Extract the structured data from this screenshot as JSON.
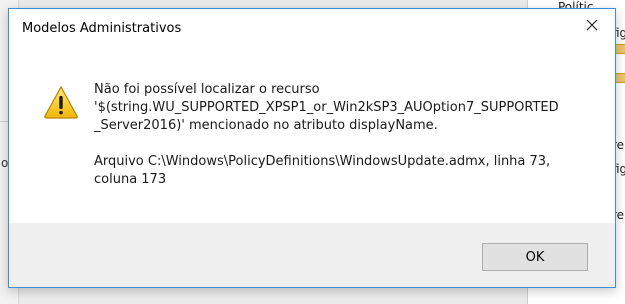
{
  "dialog": {
    "title": "Modelos Administrativos",
    "message_lines": [
      "Não foi possível localizar o recurso",
      "'$(string.WU_SUPPORTED_XPSP1_or_Win2kSP3_AUOption7_SUPPORTED",
      "_Server2016)' mencionado no atributo displayName."
    ],
    "detail_lines": [
      "Arquivo C:\\Windows\\PolicyDefinitions\\WindowsUpdate.admx, linha 73,",
      "coluna 173"
    ],
    "ok_label": "OK",
    "icon": "warning-icon"
  },
  "background": {
    "left_text": "oo",
    "right_snippets": [
      "Polític",
      "fig",
      "re",
      "fig",
      "re"
    ]
  }
}
